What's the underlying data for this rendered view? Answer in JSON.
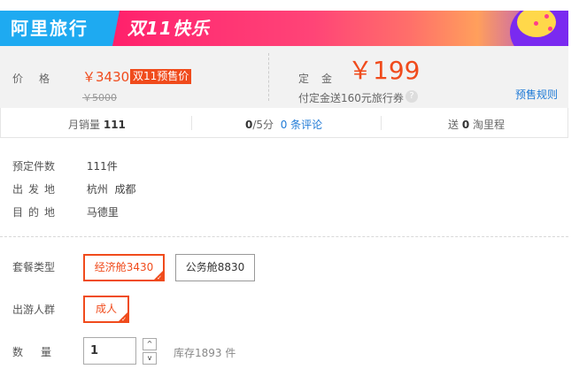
{
  "banner": {
    "brand": "阿里旅行",
    "campaign": "双11快乐"
  },
  "price": {
    "label": "价格",
    "current": "￥3430",
    "tag": "双11预售价",
    "original": "￥5000"
  },
  "deposit": {
    "label": "定金",
    "value": "￥199",
    "note": "付定金送160元旅行券",
    "help_icon": "?",
    "rule_link": "预售规则"
  },
  "stats": {
    "monthly_sales_label": "月销量",
    "monthly_sales_value": "111",
    "score_value": "0",
    "score_suffix": "/5分",
    "reviews_link": "0 条评论",
    "gift_prefix": "送",
    "gift_value": "0",
    "gift_suffix": "淘里程"
  },
  "info": {
    "booked_label": "预定件数",
    "booked_value": "111件",
    "departure_label": "出发地",
    "departure_value": "杭州  成都",
    "destination_label": "目的地",
    "destination_value": "马德里"
  },
  "options": {
    "package_label": "套餐类型",
    "package_items": [
      "经济舱3430",
      "公务舱8830"
    ],
    "package_selected": 0,
    "crowd_label": "出游人群",
    "crowd_items": [
      "成人"
    ],
    "crowd_selected": 0,
    "quantity_label": "数量",
    "quantity_value": "1",
    "stepper_up": "^",
    "stepper_down": "v",
    "stock_text": "库存1893 件"
  },
  "colors": {
    "accent": "#f04b1c",
    "brand_blue": "#1eaaf1",
    "link": "#1f7ad6"
  }
}
